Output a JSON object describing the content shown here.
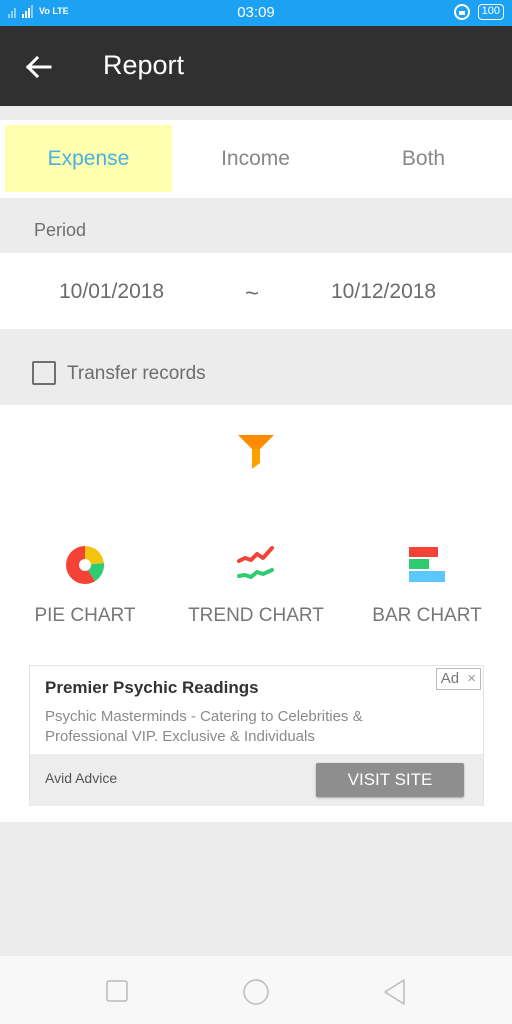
{
  "status_bar": {
    "time": "03:09",
    "network": "4G",
    "volte": "Vo LTE",
    "battery": "100"
  },
  "app_bar": {
    "title": "Report",
    "back_icon": "arrow-left-icon"
  },
  "tabs": [
    {
      "label": "Expense",
      "active": true
    },
    {
      "label": "Income",
      "active": false
    },
    {
      "label": "Both",
      "active": false
    }
  ],
  "period": {
    "label": "Period",
    "start_date": "10/01/2018",
    "separator": "~",
    "end_date": "10/12/2018"
  },
  "transfer": {
    "label": "Transfer records",
    "checked": false
  },
  "filter": {
    "icon": "funnel-icon",
    "color": "#ff8c00"
  },
  "chart_options": [
    {
      "label": "PIE CHART",
      "icon": "pie-chart-icon"
    },
    {
      "label": "TREND CHART",
      "icon": "trend-chart-icon"
    },
    {
      "label": "BAR CHART",
      "icon": "bar-chart-icon"
    }
  ],
  "ad": {
    "title": "Premier Psychic Readings",
    "description": "Psychic Masterminds - Catering to Celebrities & Professional VIP. Exclusive & Individuals",
    "badge": "Ad",
    "close_glyph": "×",
    "advertiser": "Avid Advice",
    "cta": "VISIT SITE"
  },
  "nav_bar": {
    "recents_icon": "square-icon",
    "home_icon": "circle-icon",
    "back_icon": "triangle-back-icon"
  },
  "colors": {
    "status_bar": "#1da1f2",
    "app_bar": "#303030",
    "active_tab_bg": "#ffffaf",
    "active_tab_text": "#4ab0e2",
    "red": "#f44336",
    "green": "#2ecc71",
    "yellow": "#f1c40f",
    "blue": "#5ac8fa"
  }
}
